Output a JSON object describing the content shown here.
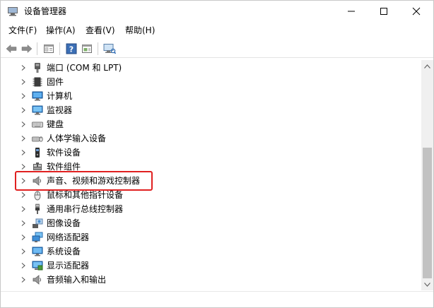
{
  "window": {
    "title": "设备管理器"
  },
  "menubar": {
    "items": [
      {
        "label": "文件(F)"
      },
      {
        "label": "操作(A)"
      },
      {
        "label": "查看(V)"
      },
      {
        "label": "帮助(H)"
      }
    ]
  },
  "toolbar": {
    "buttons": [
      "back-arrow-icon",
      "forward-arrow-icon",
      "properties-icon",
      "help-icon",
      "update-driver-icon",
      "scan-hardware-icon"
    ]
  },
  "tree": {
    "items": [
      {
        "label": "端口 (COM 和 LPT)",
        "icon": "port-icon"
      },
      {
        "label": "固件",
        "icon": "firmware-icon"
      },
      {
        "label": "计算机",
        "icon": "computer-icon"
      },
      {
        "label": "监视器",
        "icon": "monitor-icon"
      },
      {
        "label": "键盘",
        "icon": "keyboard-icon"
      },
      {
        "label": "人体学输入设备",
        "icon": "hid-icon"
      },
      {
        "label": "软件设备",
        "icon": "software-device-icon"
      },
      {
        "label": "软件组件",
        "icon": "software-component-icon"
      },
      {
        "label": "声音、视频和游戏控制器",
        "icon": "speaker-icon"
      },
      {
        "label": "鼠标和其他指针设备",
        "icon": "mouse-icon"
      },
      {
        "label": "通用串行总线控制器",
        "icon": "usb-icon"
      },
      {
        "label": "图像设备",
        "icon": "camera-icon"
      },
      {
        "label": "网络适配器",
        "icon": "network-adapter-icon"
      },
      {
        "label": "系统设备",
        "icon": "system-device-icon"
      },
      {
        "label": "显示适配器",
        "icon": "display-adapter-icon"
      },
      {
        "label": "音频输入和输出",
        "icon": "audio-io-icon"
      }
    ]
  },
  "highlight": {
    "color": "#e02020",
    "target": "声音、视频和游戏控制器"
  }
}
